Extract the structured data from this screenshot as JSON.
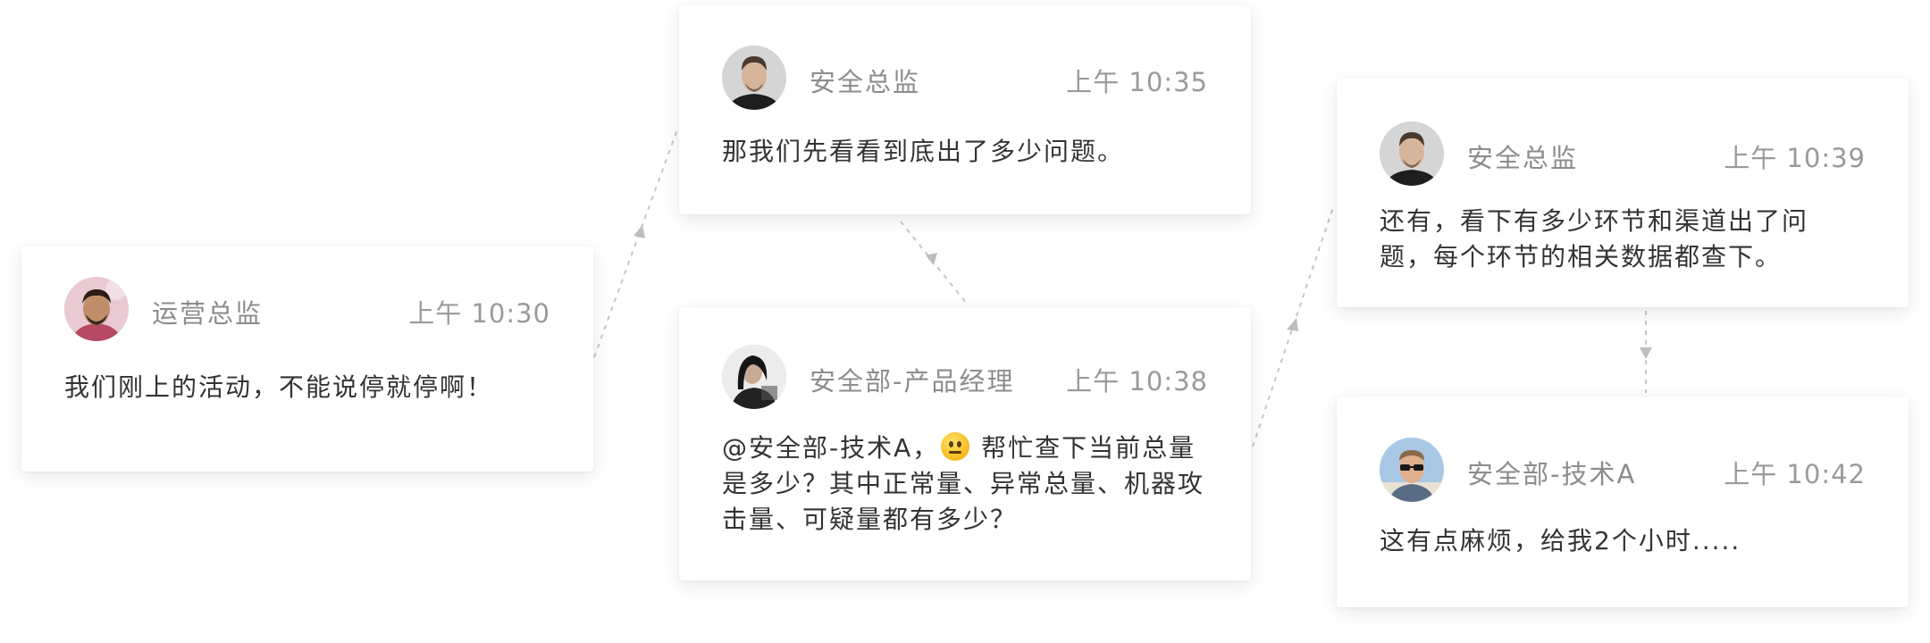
{
  "messages": [
    {
      "author": "运营总监",
      "time": "上午 10:30",
      "text": "我们刚上的活动，不能说停就停啊！",
      "avatar": "avatar-ops-director"
    },
    {
      "author": "安全总监",
      "time": "上午 10:35",
      "text": "那我们先看看到底出了多少问题。",
      "avatar": "avatar-security-director"
    },
    {
      "author": "安全部-产品经理",
      "time": "上午 10:38",
      "text_before_emoji": "@安全部-技术A，",
      "emoji": "neutral-face",
      "text_after_emoji": " 帮忙查下当前总量是多少？其中正常量、异常总量、机器攻击量、可疑量都有多少？",
      "avatar": "avatar-product-manager"
    },
    {
      "author": "安全总监",
      "time": "上午 10:39",
      "text": "还有，看下有多少环节和渠道出了问题，每个环节的相关数据都查下。",
      "avatar": "avatar-security-director"
    },
    {
      "author": "安全部-技术A",
      "time": "上午 10:42",
      "text": "这有点麻烦，给我2个小时.....",
      "avatar": "avatar-tech-a"
    }
  ],
  "colors": {
    "card_bg": "#ffffff",
    "author": "#8c8c8c",
    "time": "#9a9a9a",
    "text": "#333333",
    "connector": "#c6c6c6"
  }
}
